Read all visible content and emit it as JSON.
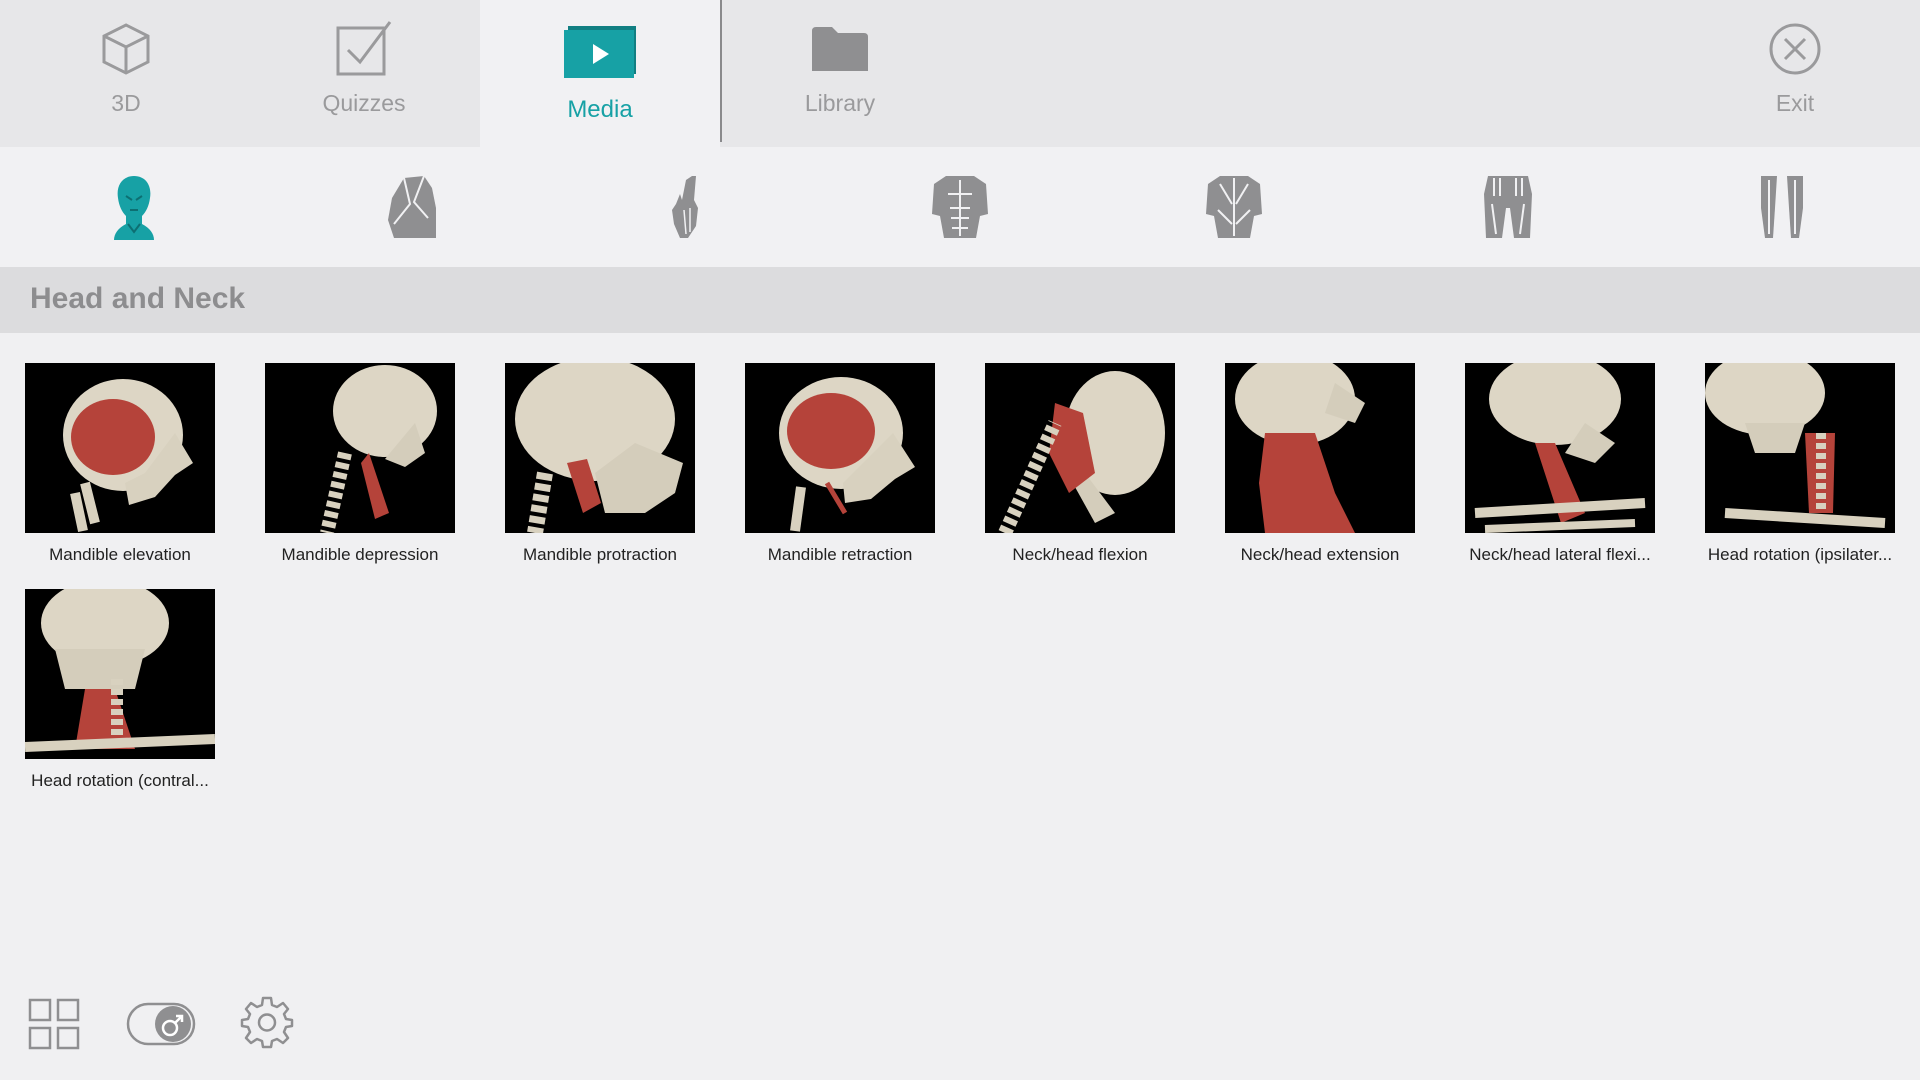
{
  "nav": {
    "tabs": [
      {
        "label": "3D",
        "icon": "cube-icon"
      },
      {
        "label": "Quizzes",
        "icon": "checkbox-icon"
      },
      {
        "label": "Media",
        "icon": "play-icon",
        "active": true
      },
      {
        "label": "Library",
        "icon": "folder-icon"
      }
    ],
    "exit_label": "Exit"
  },
  "regions": [
    {
      "name": "head-and-neck",
      "active": true
    },
    {
      "name": "shoulder"
    },
    {
      "name": "arm-and-hand"
    },
    {
      "name": "torso-front"
    },
    {
      "name": "torso-back"
    },
    {
      "name": "pelvis-and-thigh"
    },
    {
      "name": "leg"
    }
  ],
  "section": {
    "title": "Head and Neck"
  },
  "media": [
    {
      "caption": "Mandible elevation"
    },
    {
      "caption": "Mandible depression"
    },
    {
      "caption": "Mandible protraction"
    },
    {
      "caption": "Mandible retraction"
    },
    {
      "caption": "Neck/head flexion"
    },
    {
      "caption": "Neck/head extension"
    },
    {
      "caption": "Neck/head lateral flexi..."
    },
    {
      "caption": "Head rotation (ipsilater..."
    },
    {
      "caption": "Head rotation (contral..."
    }
  ],
  "colors": {
    "accent": "#17a1a5",
    "muscle": "#b5433a",
    "bone": "#ded8c8",
    "icon_gray": "#8f8f91"
  }
}
